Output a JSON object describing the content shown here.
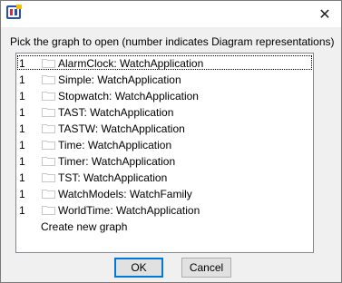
{
  "titlebar": {
    "app_icon": "app-logo-icon",
    "close_glyph": "✕",
    "close_icon": "close-icon"
  },
  "prompt": "Pick the graph to open (number indicates Diagram representations)",
  "graph_list": {
    "items": [
      {
        "count": "1",
        "label": "AlarmClock: WatchApplication",
        "icon": "folder-icon",
        "focused": true
      },
      {
        "count": "1",
        "label": "Simple: WatchApplication",
        "icon": "folder-icon"
      },
      {
        "count": "1",
        "label": "Stopwatch: WatchApplication",
        "icon": "folder-icon"
      },
      {
        "count": "1",
        "label": "TAST: WatchApplication",
        "icon": "folder-icon"
      },
      {
        "count": "1",
        "label": "TASTW: WatchApplication",
        "icon": "folder-icon"
      },
      {
        "count": "1",
        "label": "Time: WatchApplication",
        "icon": "folder-icon"
      },
      {
        "count": "1",
        "label": "Timer: WatchApplication",
        "icon": "folder-icon"
      },
      {
        "count": "1",
        "label": "TST: WatchApplication",
        "icon": "folder-icon"
      },
      {
        "count": "1",
        "label": "WatchModels: WatchFamily",
        "icon": "folder-icon"
      },
      {
        "count": "1",
        "label": "WorldTime: WatchApplication",
        "icon": "folder-icon"
      }
    ],
    "create_new": "Create new graph"
  },
  "buttons": {
    "ok_label": "OK",
    "cancel_label": "Cancel"
  },
  "colors": {
    "focus_accent": "#0078d7",
    "dialog_bg": "#f0f0f0"
  }
}
